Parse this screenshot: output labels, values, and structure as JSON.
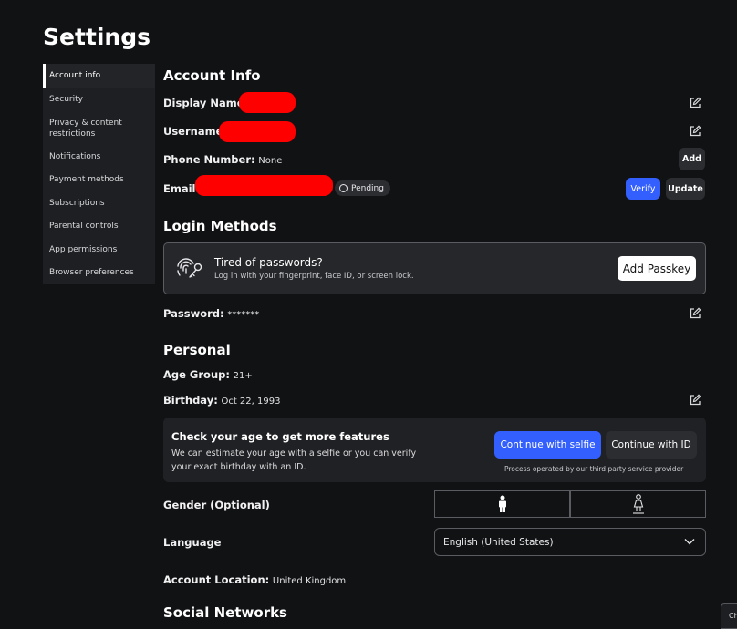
{
  "page": {
    "title": "Settings"
  },
  "sidebar": {
    "items": [
      {
        "label": "Account info",
        "active": true
      },
      {
        "label": "Security"
      },
      {
        "label": "Privacy & content restrictions"
      },
      {
        "label": "Notifications"
      },
      {
        "label": "Payment methods"
      },
      {
        "label": "Subscriptions"
      },
      {
        "label": "Parental controls"
      },
      {
        "label": "App permissions"
      },
      {
        "label": "Browser preferences"
      }
    ]
  },
  "account_info": {
    "heading": "Account Info",
    "display_name_label": "Display Name:",
    "username_label": "Username:",
    "phone_label": "Phone Number:",
    "phone_value": "None",
    "phone_add_button": "Add",
    "email_label": "Email:",
    "email_status": "Pending",
    "verify_button": "Verify",
    "update_button": "Update"
  },
  "login_methods": {
    "heading": "Login Methods",
    "passkey_title": "Tired of passwords?",
    "passkey_subtitle": "Log in with your fingerprint, face ID, or screen lock.",
    "add_passkey_button": "Add Passkey",
    "password_label": "Password:",
    "password_value": "*******"
  },
  "personal": {
    "heading": "Personal",
    "age_group_label": "Age Group:",
    "age_group_value": "21+",
    "birthday_label": "Birthday:",
    "birthday_value": "Oct 22, 1993",
    "age_check_title": "Check your age to get more features",
    "age_check_body_line1": "We can estimate your age with a selfie or you can verify",
    "age_check_body_line2": "your exact birthday with an ID.",
    "continue_selfie_button": "Continue with selfie",
    "continue_id_button": "Continue with ID",
    "provider_note": "Process operated by our third party service provider",
    "gender_label": "Gender (Optional)",
    "language_label": "Language",
    "language_value": "English (United States)",
    "location_label": "Account Location:",
    "location_value": "United Kingdom"
  },
  "social": {
    "heading": "Social Networks"
  },
  "chat_stub": {
    "label": "Ch"
  },
  "colors": {
    "accent": "#335fff",
    "redaction": "#ff0000",
    "background": "#111214"
  }
}
